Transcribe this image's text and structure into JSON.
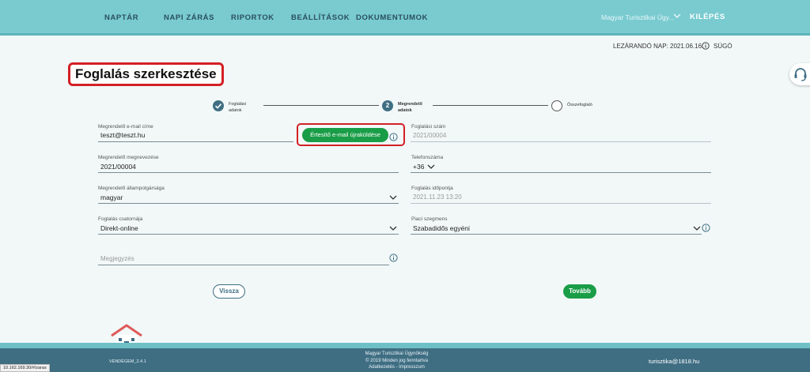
{
  "nav": {
    "items": [
      "NAPTÁR",
      "NAPI ZÁRÁS",
      "RIPORTOK",
      "BEÁLLÍTÁSOK",
      "DOKUMENTUMOK"
    ],
    "org": "Magyar Turisztikai Ügy...",
    "logout": "KILÉPÉS"
  },
  "subheader": {
    "closing_day": "LEZÁRANDÓ NAP: 2021.06.16.",
    "help": "SÚGÓ"
  },
  "page_title": "Foglalás szerkesztése",
  "stepper": {
    "step1": [
      "Foglalási",
      "adatok"
    ],
    "step2_number": "2",
    "step2": [
      "Megrendelő",
      "adatok"
    ],
    "step3": "Összefoglaló"
  },
  "form": {
    "email_label": "Megrendelő e-mail címe",
    "email_value": "teszt@teszt.hu",
    "resend_label": "Értesítő e-mail újraküldése",
    "booking_number_label": "Foglalási szám",
    "booking_number_value": "2021/00004",
    "name_label": "Megrendelő megnevezése",
    "name_value": "2021/00004",
    "phone_label": "Telefonszáma",
    "phone_prefix": "+36",
    "nationality_label": "Megrendelő állampolgársága",
    "nationality_value": "magyar",
    "booking_time_label": "Foglalás időpontja",
    "booking_time_value": "2021.11.23 13:20",
    "channel_label": "Foglalás csatornája",
    "channel_value": "Direkt-online",
    "segment_label": "Piaci szegmens",
    "segment_value": "Szabadidős egyéni",
    "note_placeholder": "Megjegyzés"
  },
  "buttons": {
    "back": "Vissza",
    "next": "Tovább"
  },
  "footer": {
    "version": "VENDÉGEM_2.4.1",
    "org": "Magyar Turisztikai Ügynökség",
    "copyright": "© 2019 Minden jog fenntartva",
    "links": "Adatkezelés - Impresszum",
    "email": "turisztika@1818.hu"
  },
  "status_url": "10.162.169.30/#/zaras",
  "colors": {
    "nav_bg": "#79cbd0",
    "primary": "#3f6e83",
    "success": "#1a9d47",
    "highlight": "#d32025"
  }
}
